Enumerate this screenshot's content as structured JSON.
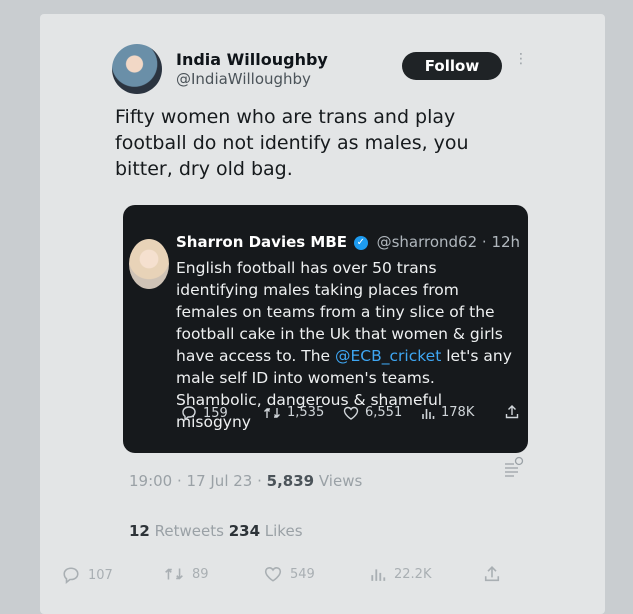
{
  "author": {
    "name": "India Willoughby",
    "handle": "@IndiaWilloughby",
    "follow_label": "Follow",
    "more": "⋮"
  },
  "tweet_text": "Fifty women who are trans and play football do not identify as males, you bitter, dry old bag.",
  "quote": {
    "name": "Sharron Davies MBE",
    "handle_time": "@sharrond62 · 12h",
    "more": "···",
    "text_part1": "English football has over 50 trans identifying males taking places from females  on teams from a tiny slice of the football cake in the Uk that women & girls have access to. The ",
    "mention": "@ECB_cricket",
    "text_part2": " let's any male self ID into women's teams. Shambolic, dangerous & shameful misogyny",
    "stats": {
      "replies": "159",
      "retweets": "1,535",
      "likes": "6,551",
      "views": "178K"
    }
  },
  "meta": {
    "time": "19:00 · 17 Jul 23 · ",
    "views_count": "5,839",
    "views_label": " Views"
  },
  "engagement": {
    "retweets_count": "12",
    "retweets_label": " Retweets  ",
    "likes_count": "234",
    "likes_label": " Likes"
  },
  "bottom_stats": {
    "replies": "107",
    "retweets": "89",
    "likes": "549",
    "views": "22.2K"
  },
  "colors": {
    "background": "#c9cdd0",
    "quote_bg": "#16191c",
    "link": "#3ea6f2",
    "verified": "#1d9bf0"
  }
}
